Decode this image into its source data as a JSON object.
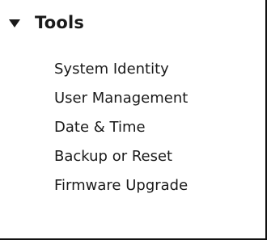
{
  "section": {
    "title": "Tools",
    "expanded_icon": "triangle-down-icon"
  },
  "menu": {
    "items": [
      {
        "label": "System Identity"
      },
      {
        "label": "User Management"
      },
      {
        "label": "Date & Time"
      },
      {
        "label": "Backup or Reset"
      },
      {
        "label": "Firmware Upgrade"
      }
    ]
  },
  "colors": {
    "text": "#1a1a1a",
    "border": "#111111",
    "background": "#ffffff"
  }
}
